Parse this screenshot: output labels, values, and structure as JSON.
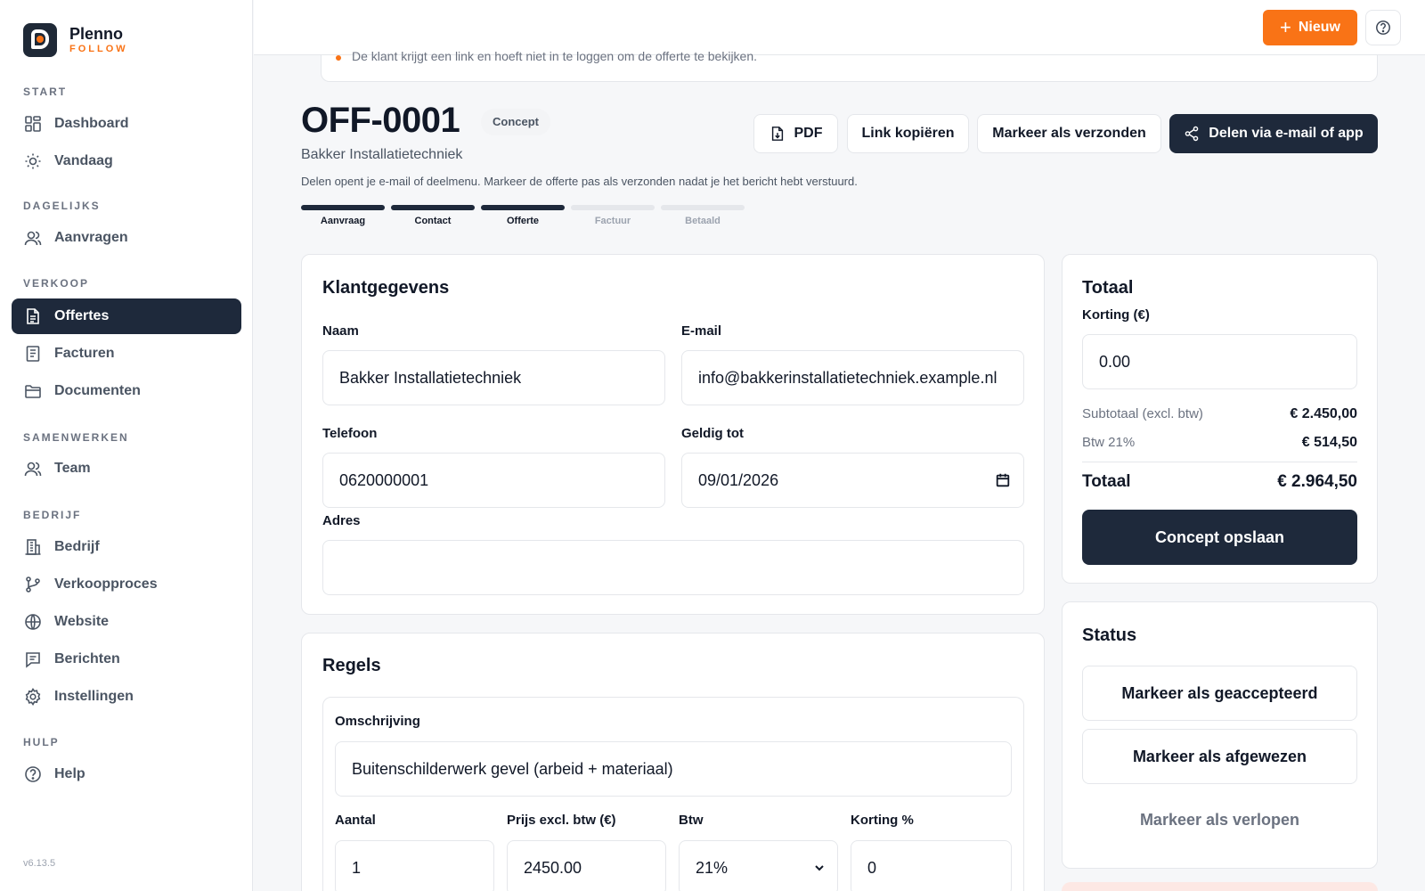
{
  "app": {
    "name": "Plenno",
    "subtitle": "FOLLOW",
    "version": "v6.13.5"
  },
  "sidebar": {
    "sections": [
      {
        "label": "START"
      },
      {
        "label": "DAGELIJKS"
      },
      {
        "label": "VERKOOP"
      },
      {
        "label": "SAMENWERKEN"
      },
      {
        "label": "BEDRIJF"
      },
      {
        "label": "HULP"
      }
    ],
    "items": [
      {
        "label": "Dashboard",
        "icon": "dashboard-icon"
      },
      {
        "label": "Vandaag",
        "icon": "sun-icon"
      },
      {
        "label": "Aanvragen",
        "icon": "users-icon"
      },
      {
        "label": "Offertes",
        "icon": "document-icon",
        "active": true
      },
      {
        "label": "Facturen",
        "icon": "invoice-icon"
      },
      {
        "label": "Documenten",
        "icon": "folder-icon"
      },
      {
        "label": "Team",
        "icon": "team-icon"
      },
      {
        "label": "Bedrijf",
        "icon": "building-icon"
      },
      {
        "label": "Verkoopproces",
        "icon": "branch-icon"
      },
      {
        "label": "Website",
        "icon": "globe-icon"
      },
      {
        "label": "Berichten",
        "icon": "message-icon"
      },
      {
        "label": "Instellingen",
        "icon": "gear-icon"
      },
      {
        "label": "Help",
        "icon": "help-icon"
      }
    ]
  },
  "topbar": {
    "new_label": "Nieuw"
  },
  "notice": {
    "text": "De klant krijgt een link en hoeft niet in te loggen om de offerte te bekijken."
  },
  "quote": {
    "number": "OFF-0001",
    "status": "Concept",
    "company": "Bakker Installatietechniek",
    "hint": "Delen opent je e-mail of deelmenu. Markeer de offerte pas als verzonden nadat je het bericht hebt verstuurd.",
    "actions": {
      "pdf": "PDF",
      "copy_link": "Link kopiëren",
      "mark_sent": "Markeer als verzonden",
      "share": "Delen via e-mail of app"
    }
  },
  "steps": [
    {
      "label": "Aanvraag",
      "done": true
    },
    {
      "label": "Contact",
      "done": true
    },
    {
      "label": "Offerte",
      "done": true
    },
    {
      "label": "Factuur",
      "done": false
    },
    {
      "label": "Betaald",
      "done": false
    }
  ],
  "customer": {
    "title": "Klantgegevens",
    "name_label": "Naam",
    "name": "Bakker Installatietechniek",
    "email_label": "E-mail",
    "email": "info@bakkerinstallatietechniek.example.nl",
    "phone_label": "Telefoon",
    "phone": "0620000001",
    "valid_label": "Geldig tot",
    "valid": "09/01/2026",
    "address_label": "Adres",
    "address": ""
  },
  "lines": {
    "title": "Regels",
    "desc_label": "Omschrijving",
    "desc": "Buitenschilderwerk gevel (arbeid + materiaal)",
    "qty_label": "Aantal",
    "qty": "1",
    "price_label": "Prijs excl. btw (€)",
    "price": "2450.00",
    "vat_label": "Btw",
    "vat": "21%",
    "discount_label": "Korting %",
    "discount": "0"
  },
  "totals": {
    "title": "Totaal",
    "discount_label": "Korting (€)",
    "discount": "0.00",
    "subtotal_label": "Subtotaal (excl. btw)",
    "subtotal": "€ 2.450,00",
    "vat_label": "Btw 21%",
    "vat": "€ 514,50",
    "total_label": "Totaal",
    "total": "€ 2.964,50",
    "save_label": "Concept opslaan"
  },
  "status": {
    "title": "Status",
    "accepted": "Markeer als geaccepteerd",
    "rejected": "Markeer als afgewezen",
    "expired": "Markeer als verlopen"
  },
  "colors": {
    "accent": "#f97316",
    "dark": "#1e293b"
  }
}
